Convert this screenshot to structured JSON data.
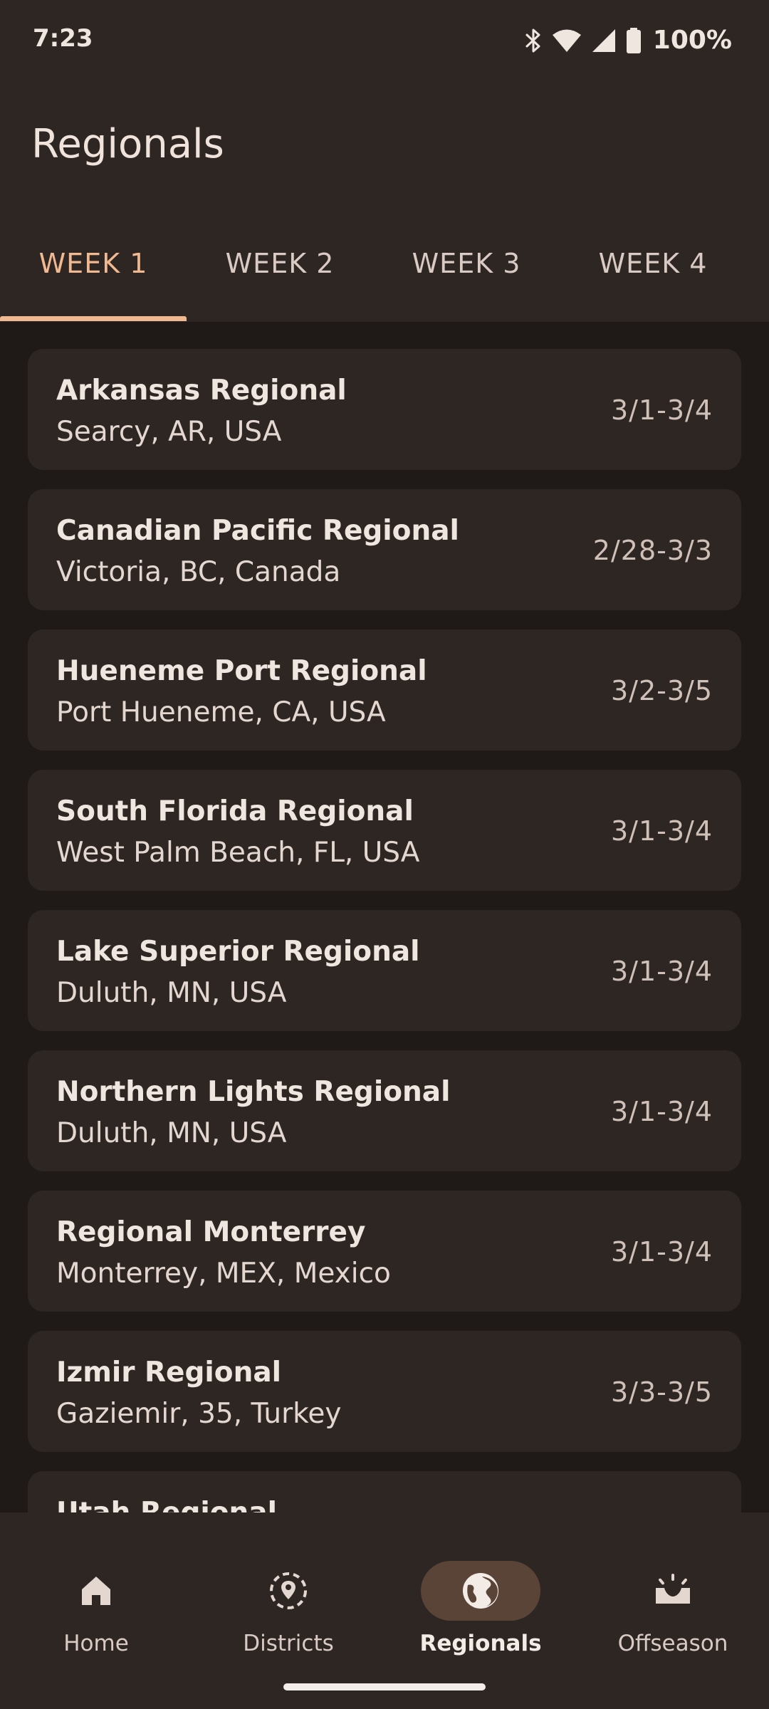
{
  "status_bar": {
    "time": "7:23",
    "battery": "100%",
    "icons": [
      "bluetooth-icon",
      "wifi-icon",
      "signal-icon",
      "battery-icon"
    ]
  },
  "header": {
    "title": "Regionals"
  },
  "tabs": [
    {
      "label": "WEEK 1",
      "active": true
    },
    {
      "label": "WEEK 2",
      "active": false
    },
    {
      "label": "WEEK 3",
      "active": false
    },
    {
      "label": "WEEK 4",
      "active": false
    }
  ],
  "events": [
    {
      "name": "Arkansas Regional",
      "location": "Searcy, AR, USA",
      "dates": "3/1-3/4"
    },
    {
      "name": "Canadian Pacific Regional",
      "location": "Victoria, BC, Canada",
      "dates": "2/28-3/3"
    },
    {
      "name": "Hueneme Port Regional",
      "location": "Port Hueneme, CA, USA",
      "dates": "3/2-3/5"
    },
    {
      "name": "South Florida Regional",
      "location": "West Palm Beach, FL, USA",
      "dates": "3/1-3/4"
    },
    {
      "name": "Lake Superior Regional",
      "location": "Duluth, MN, USA",
      "dates": "3/1-3/4"
    },
    {
      "name": "Northern Lights Regional",
      "location": "Duluth, MN, USA",
      "dates": "3/1-3/4"
    },
    {
      "name": "Regional Monterrey",
      "location": "Monterrey, MEX, Mexico",
      "dates": "3/1-3/4"
    },
    {
      "name": "Izmir Regional",
      "location": "Gaziemir, 35, Turkey",
      "dates": "3/3-3/5"
    },
    {
      "name": "Utah Regional",
      "location": "",
      "dates": ""
    }
  ],
  "bottom_nav": [
    {
      "label": "Home",
      "icon": "home-icon",
      "active": false
    },
    {
      "label": "Districts",
      "icon": "districts-icon",
      "active": false
    },
    {
      "label": "Regionals",
      "icon": "globe-icon",
      "active": true
    },
    {
      "label": "Offseason",
      "icon": "offseason-icon",
      "active": false
    }
  ],
  "colors": {
    "background": "#1f1a18",
    "surface": "#2e2623",
    "accent": "#f0b991",
    "active_pill": "#5a4437",
    "text_primary": "#f0e6e0"
  }
}
